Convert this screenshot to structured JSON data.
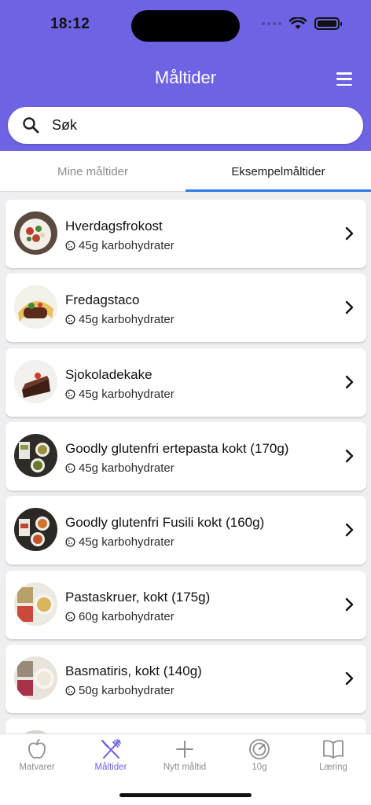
{
  "status_bar": {
    "time": "18:12"
  },
  "header": {
    "title": "Måltider"
  },
  "search": {
    "value": "Søk"
  },
  "tabs": [
    {
      "label": "Mine måltider",
      "active": false
    },
    {
      "label": "Eksempelmåltider",
      "active": true
    }
  ],
  "meals": [
    {
      "name": "Hverdagsfrokost",
      "carbs": "45g karbohydrater"
    },
    {
      "name": "Fredagstaco",
      "carbs": "45g karbohydrater"
    },
    {
      "name": "Sjokoladekake",
      "carbs": "45g karbohydrater"
    },
    {
      "name": "Goodly glutenfri ertepasta kokt (170g)",
      "carbs": "45g karbohydrater"
    },
    {
      "name": "Goodly glutenfri Fusili kokt (160g)",
      "carbs": "45g karbohydrater"
    },
    {
      "name": "Pastaskruer, kokt (175g)",
      "carbs": "60g karbohydrater"
    },
    {
      "name": "Basmatiris, kokt (140g)",
      "carbs": "50g karbohydrater"
    }
  ],
  "bottom_nav": [
    {
      "label": "Matvarer",
      "icon": "apple-icon",
      "active": false
    },
    {
      "label": "Måltider",
      "icon": "cutlery-icon",
      "active": true
    },
    {
      "label": "Nytt måltid",
      "icon": "plus-icon",
      "active": false
    },
    {
      "label": "10g",
      "icon": "gauge-icon",
      "active": false
    },
    {
      "label": "Læring",
      "icon": "book-icon",
      "active": false
    }
  ],
  "colors": {
    "accent": "#6e63e2",
    "tab_indicator": "#2d7be5",
    "background": "#efeff2"
  }
}
